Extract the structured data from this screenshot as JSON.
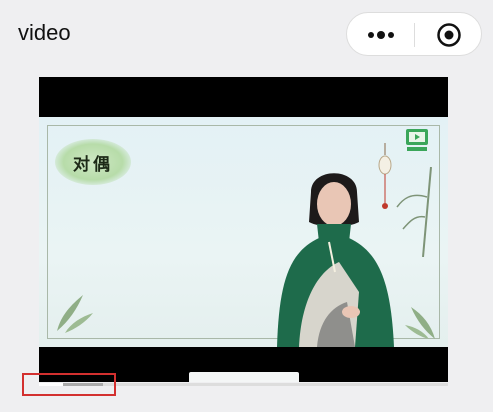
{
  "header": {
    "title": "video"
  },
  "capsule": {
    "more_icon": "more-dots-icon",
    "close_icon": "target-circle-icon"
  },
  "video": {
    "topic_label": "对偶",
    "progress_fraction": 0.06,
    "colors": {
      "highlight": "#d3302f"
    }
  }
}
